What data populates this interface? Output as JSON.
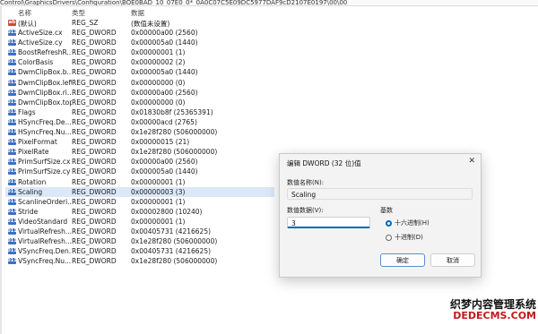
{
  "path_bar": "Control\\GraphicsDrivers\\Configuration\\BOE0BAD_10_07E0_0*_0A0C07C5E09DC5977DAF9cD2107E0197\\00\\00",
  "columns": {
    "name": "名称",
    "type": "类型",
    "data": "数据"
  },
  "rows": [
    {
      "icon": "string",
      "name": "(默认)",
      "type": "REG_SZ",
      "data": "(数值未设置)"
    },
    {
      "icon": "dword",
      "name": "ActiveSize.cx",
      "type": "REG_DWORD",
      "data": "0x00000a00 (2560)"
    },
    {
      "icon": "dword",
      "name": "ActiveSize.cy",
      "type": "REG_DWORD",
      "data": "0x000005a0 (1440)"
    },
    {
      "icon": "dword",
      "name": "BoostRefreshR...",
      "type": "REG_DWORD",
      "data": "0x00000001 (1)"
    },
    {
      "icon": "dword",
      "name": "ColorBasis",
      "type": "REG_DWORD",
      "data": "0x00000002 (2)"
    },
    {
      "icon": "dword",
      "name": "DwmClipBox.b...",
      "type": "REG_DWORD",
      "data": "0x000005a0 (1440)"
    },
    {
      "icon": "dword",
      "name": "DwmClipBox.left",
      "type": "REG_DWORD",
      "data": "0x00000000 (0)"
    },
    {
      "icon": "dword",
      "name": "DwmClipBox.ri...",
      "type": "REG_DWORD",
      "data": "0x00000a00 (2560)"
    },
    {
      "icon": "dword",
      "name": "DwmClipBox.top",
      "type": "REG_DWORD",
      "data": "0x00000000 (0)"
    },
    {
      "icon": "dword",
      "name": "Flags",
      "type": "REG_DWORD",
      "data": "0x01830b8f (25365391)"
    },
    {
      "icon": "dword",
      "name": "HSyncFreq.De...",
      "type": "REG_DWORD",
      "data": "0x00000acd (2765)"
    },
    {
      "icon": "dword",
      "name": "HSyncFreq.Nu...",
      "type": "REG_DWORD",
      "data": "0x1e28f280 (506000000)"
    },
    {
      "icon": "dword",
      "name": "PixelFormat",
      "type": "REG_DWORD",
      "data": "0x00000015 (21)"
    },
    {
      "icon": "dword",
      "name": "PixelRate",
      "type": "REG_DWORD",
      "data": "0x1e28f280 (506000000)"
    },
    {
      "icon": "dword",
      "name": "PrimSurfSize.cx",
      "type": "REG_DWORD",
      "data": "0x00000a00 (2560)"
    },
    {
      "icon": "dword",
      "name": "PrimSurfSize.cy",
      "type": "REG_DWORD",
      "data": "0x000005a0 (1440)"
    },
    {
      "icon": "dword",
      "name": "Rotation",
      "type": "REG_DWORD",
      "data": "0x00000001 (1)"
    },
    {
      "icon": "dword",
      "name": "Scaling",
      "type": "REG_DWORD",
      "data": "0x00000003 (3)",
      "selected": true
    },
    {
      "icon": "dword",
      "name": "ScanlineOrderi...",
      "type": "REG_DWORD",
      "data": "0x00000001 (1)"
    },
    {
      "icon": "dword",
      "name": "Stride",
      "type": "REG_DWORD",
      "data": "0x00002800 (10240)"
    },
    {
      "icon": "dword",
      "name": "VideoStandard",
      "type": "REG_DWORD",
      "data": "0x00000001 (1)"
    },
    {
      "icon": "dword",
      "name": "VirtualRefresh...",
      "type": "REG_DWORD",
      "data": "0x00405731 (4216625)"
    },
    {
      "icon": "dword",
      "name": "VirtualRefresh...",
      "type": "REG_DWORD",
      "data": "0x1e28f280 (506000000)"
    },
    {
      "icon": "dword",
      "name": "VSyncFreq.Den...",
      "type": "REG_DWORD",
      "data": "0x00405731 (4216625)"
    },
    {
      "icon": "dword",
      "name": "VSyncFreq.Nu...",
      "type": "REG_DWORD",
      "data": "0x1e28f280 (506000000)"
    }
  ],
  "icons": {
    "string": "ab",
    "dword": "011"
  },
  "dialog": {
    "title": "编辑 DWORD (32 位)值",
    "close": "✕",
    "value_name_label": "数值名称(N):",
    "value_name": "Scaling",
    "value_data_label": "数值数据(V):",
    "value_data": "3",
    "base_label": "基数",
    "radio_hex": "十六进制(H)",
    "radio_dec": "十进制(D)",
    "selected_base": "hex",
    "ok": "确定",
    "cancel": "取消"
  },
  "watermark": {
    "line1": "织梦内容管理系统",
    "line2": "DEDECMS.COM"
  },
  "colors": {
    "accent": "#0067c0",
    "selection": "#dbe8f7",
    "dword_icon": "#3e6fbf",
    "string_icon": "#d44a36",
    "watermark_red": "#c0191e"
  }
}
